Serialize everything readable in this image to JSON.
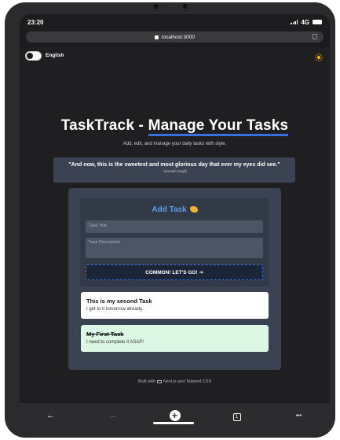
{
  "status": {
    "time": "23:20",
    "network": "4G"
  },
  "browser": {
    "url": "localhost:3000"
  },
  "header": {
    "language_label": "English",
    "theme_icon": "sun-icon"
  },
  "hero": {
    "title_prefix": "TaskTrack - ",
    "title_highlight": "Manage Your Tasks",
    "subtitle": "Add, edit, and manage your daily tasks with style."
  },
  "quote": {
    "text": "\"And now, this is the sweetest and most glorious day that ever my eyes did see.\"",
    "author": "- Donald Cargill"
  },
  "form": {
    "title": "Add Task",
    "title_icon": "writing-hand-icon",
    "title_placeholder": "Task Title",
    "description_placeholder": "Task Description",
    "submit_label": "COMMON! LET'S GO! ➜"
  },
  "tasks": [
    {
      "title": "This is my second Task",
      "description": "I get to it tomorrow already..",
      "completed": false,
      "color": "#ffffff"
    },
    {
      "title": "My First Task",
      "description": "I need to complete it ASAP!",
      "completed": true,
      "color": "#dcf7e3"
    }
  ],
  "footer": {
    "prefix": "Built with",
    "suffix": "Next.js and Tailwind CSS"
  },
  "toolbar": {
    "back": "←",
    "forward": "→",
    "new_tab": "+",
    "tab_count": "1",
    "more": "•••"
  },
  "colors": {
    "accent": "#3b6fe0",
    "form_title": "#5b9df0",
    "panel": "#3b4352"
  }
}
